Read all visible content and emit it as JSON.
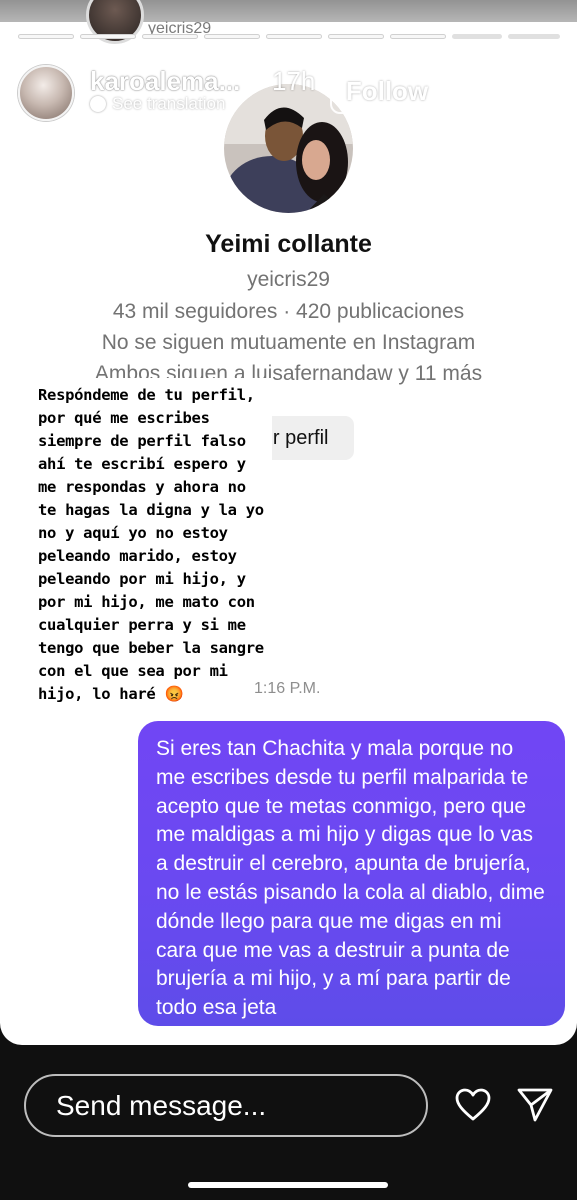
{
  "story": {
    "previous_username": "yeicris29",
    "progress_segments": 9,
    "author": {
      "username": "karoalema...",
      "time_ago": "17h",
      "see_translation": "See translation",
      "follow_label": "Follow"
    }
  },
  "profile_card": {
    "name": "Yeimi collante",
    "handle": "yeicris29",
    "stats": "43 mil seguidores · 420 publicaciones",
    "mutual": "No se siguen mutuamente en Instagram",
    "both_follow": "Ambos siguen a luisafernandaw y 11 más",
    "view_profile_label": "Ver perfil"
  },
  "sticker_text": "Respóndeme de tu perfil, por qué me escribes siempre de perfil falso ahí te escribí espero y me respondas y ahora no te hagas la digna y la yo no y aquí yo no estoy peleando marido, estoy peleando por mi hijo, y por mi hijo, me mato con cualquier perra y si me tengo que beber la sangre con el que sea por mi hijo, lo haré 😡",
  "message_time": "1:16 P.M.",
  "outgoing_message": "Si eres tan Chachita y mala porque no me escribes desde tu perfil malparida te acepto que te metas conmigo, pero que me maldigas a mi hijo y digas que lo vas a destruir el cerebro, apunta de brujería, no le estás pisando la cola al diablo, dime dónde llego para que me digas en mi cara que me vas a destruir a punta de brujería a mi hijo, y a mí para partir de todo esa jeta",
  "composer": {
    "placeholder": "Send message..."
  },
  "colors": {
    "bubble": "#6a49f1",
    "background": "#101010",
    "card": "#ffffff"
  }
}
